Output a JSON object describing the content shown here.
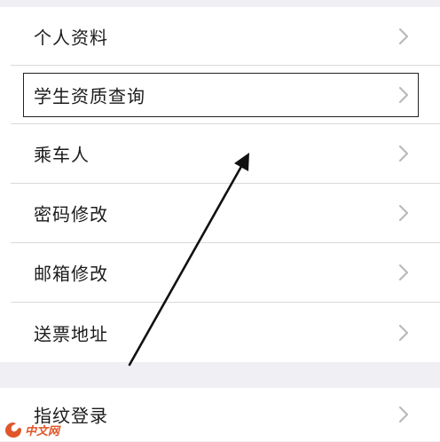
{
  "menu": {
    "items": [
      {
        "label": "个人资料"
      },
      {
        "label": "学生资质查询"
      },
      {
        "label": "乘车人"
      },
      {
        "label": "密码修改"
      },
      {
        "label": "邮箱修改"
      },
      {
        "label": "送票地址"
      }
    ],
    "fingerprint_label": "指纹登录"
  },
  "icons": {
    "row_chevron": "chevron-right-icon",
    "annotation": "arrow-pointer-icon",
    "watermark_logo": "php-logo-icon"
  },
  "watermark": {
    "text": "中文网"
  },
  "colors": {
    "background": "#efeff4",
    "row_background": "#ffffff",
    "chevron": "#c7c7cc",
    "watermark": "#e0562a"
  }
}
